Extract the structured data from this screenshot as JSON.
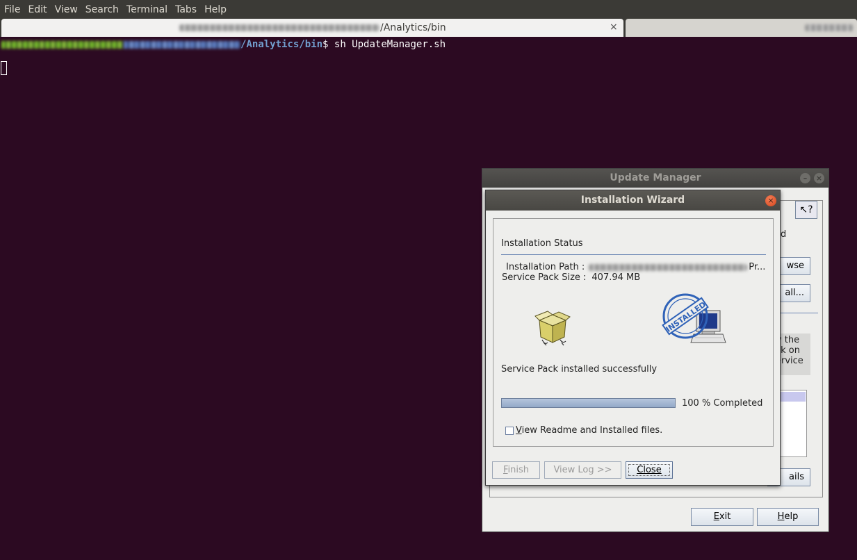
{
  "menubar": {
    "items": [
      "File",
      "Edit",
      "View",
      "Search",
      "Terminal",
      "Tabs",
      "Help"
    ]
  },
  "tabs": {
    "active_title_suffix": "/Analytics/bin",
    "close_glyph": "×"
  },
  "terminal": {
    "prompt_path": "/Analytics/bin",
    "prompt_symbol": "$",
    "command": "sh UpdateManager.sh"
  },
  "update_manager": {
    "title": "Update Manager",
    "help_glyph": "?",
    "fragments": {
      "d": "d",
      "browse": "wse",
      "all": "all...",
      "text1": "w the",
      "text2": "ck on",
      "text3": "ervice",
      "details": "ails"
    },
    "buttons": {
      "exit": "Exit",
      "help": "Help"
    }
  },
  "wizard": {
    "title": "Installation Wizard",
    "section_title": "Installation Status",
    "path_label": "Installation Path :",
    "path_suffix": "Pr...",
    "size_label": "Service Pack Size :",
    "size_value": "407.94 MB",
    "status_message": "Service Pack installed successfully",
    "progress_percent": 100,
    "progress_text": "100 % Completed",
    "readme_label": "View Readme and Installed files.",
    "readme_checked": false,
    "stamp_text": "INSTALLED",
    "buttons": {
      "finish": "Finish",
      "view_log": "View Log >>",
      "close": "Close"
    }
  },
  "colors": {
    "terminal_bg": "#2c0a22",
    "prompt_path": "#729fcf",
    "progress_fill": "#93a9c8",
    "stamp_blue": "#2f62b8"
  }
}
